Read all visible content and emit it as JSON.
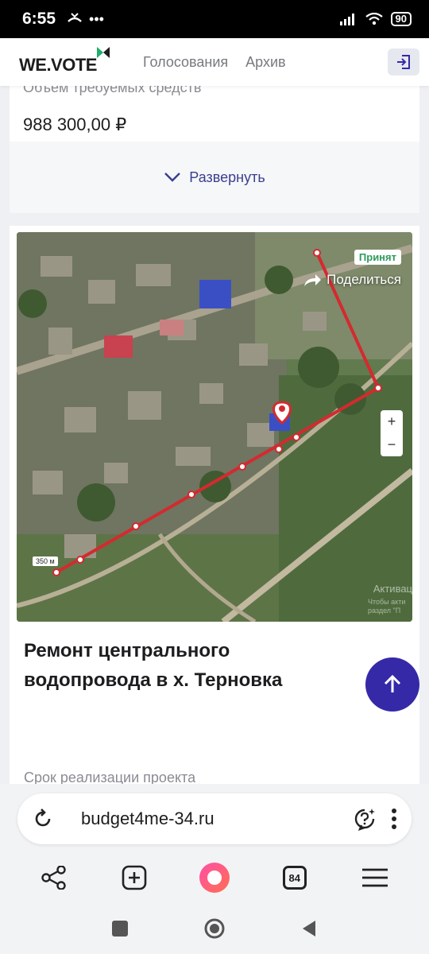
{
  "status": {
    "time": "6:55",
    "battery": "90"
  },
  "header": {
    "logo": "WE.VOTE",
    "nav": [
      {
        "label": "Голосования"
      },
      {
        "label": "Архив"
      }
    ]
  },
  "funding": {
    "label": "Объем требуемых средств",
    "amount": "988 300,00 ₽",
    "expand_label": "Развернуть"
  },
  "project": {
    "status_badge": "Принят",
    "share_label": "Поделиться",
    "zoom_in": "+",
    "zoom_out": "−",
    "scale": "350 м",
    "watermark_line1": "Активац",
    "watermark_line2": "Чтобы акти раздел \"П",
    "title": "Ремонт центрального водопровода в х. Терновка",
    "term_label": "Срок реализации проекта"
  },
  "browser": {
    "url": "budget4me-34.ru",
    "tabs_count": "84"
  },
  "colors": {
    "accent": "#3629a8",
    "badge_green": "#2e9a5c",
    "route": "#d42a2f"
  }
}
